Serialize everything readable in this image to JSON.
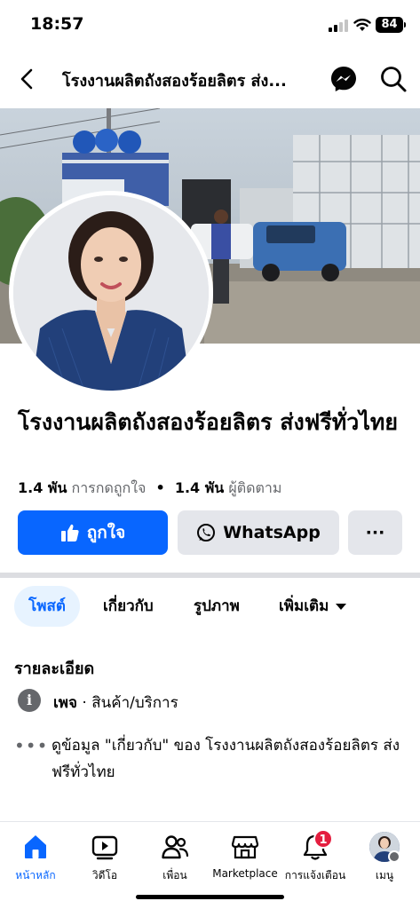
{
  "status_bar": {
    "time": "18:57",
    "battery": "84"
  },
  "header": {
    "title": "โรงงานผลิตถังสองร้อยลิตร ส่ง..."
  },
  "page": {
    "name": "โรงงานผลิตถังสองร้อยลิตร ส่งฟรีทั่วไทย",
    "likes_count": "1.4 พัน",
    "likes_label": "การกดถูกใจ",
    "separator": "•",
    "followers_count": "1.4 พัน",
    "followers_label": "ผู้ติดตาม"
  },
  "actions": {
    "like_label": "ถูกใจ",
    "whatsapp_label": "WhatsApp",
    "more_label": "···"
  },
  "tabs": [
    {
      "label": "โพสต์",
      "active": true
    },
    {
      "label": "เกี่ยวกับ"
    },
    {
      "label": "รูปภาพ"
    },
    {
      "label": "เพิ่มเติม"
    }
  ],
  "details": {
    "title": "รายละเอียด",
    "category_prefix": "เพจ",
    "category_sep": " · ",
    "category": "สินค้า/บริการ",
    "about_link": "ดูข้อมูล \"เกี่ยวกับ\" ของ โรงงานผลิตถังสองร้อยลิตร ส่งฟรีทั่วไทย"
  },
  "bottom_nav": [
    {
      "label": "หน้าหลัก",
      "icon": "home-icon",
      "active": true
    },
    {
      "label": "วิดีโอ",
      "icon": "video-icon"
    },
    {
      "label": "เพื่อน",
      "icon": "friends-icon"
    },
    {
      "label": "Marketplace",
      "icon": "marketplace-icon"
    },
    {
      "label": "การแจ้งเตือน",
      "icon": "bell-icon"
    },
    {
      "label": "เมนู",
      "icon": "profile-avatar"
    }
  ],
  "notification_badge": "1",
  "colors": {
    "brand": "#0866ff",
    "badge": "#e41e3f",
    "secondary_text": "#65676b"
  }
}
